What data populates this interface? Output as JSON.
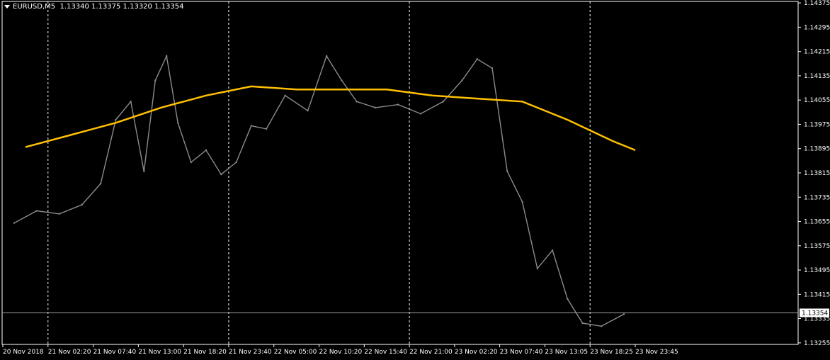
{
  "window": {
    "symbol": "EURUSD,M5",
    "quote": "1.13340 1.13375 1.13320 1.13354"
  },
  "chart_data": {
    "type": "line",
    "symbol": "EURUSD",
    "timeframe": "M5",
    "x_tick_labels": [
      "20 Nov 2018",
      "21 Nov 02:20",
      "21 Nov 07:40",
      "21 Nov 13:00",
      "21 Nov 18:20",
      "21 Nov 23:40",
      "22 Nov 05:00",
      "22 Nov 10:20",
      "22 Nov 15:40",
      "22 Nov 21:00",
      "23 Nov 02:20",
      "23 Nov 07:40",
      "23 Nov 13:05",
      "23 Nov 18:25",
      "23 Nov 23:45"
    ],
    "y_tick_labels": [
      "1.14375",
      "1.14295",
      "1.14215",
      "1.14135",
      "1.14055",
      "1.13975",
      "1.13895",
      "1.13815",
      "1.13735",
      "1.13655",
      "1.13575",
      "1.13495",
      "1.13415",
      "1.13335",
      "1.13255"
    ],
    "ylim": [
      1.1325,
      1.1438
    ],
    "current_price": "1.13354",
    "grid": "vertical dashed day separators",
    "colors": {
      "background": "#000000",
      "price": "#8c8c8c",
      "up": "#22cc22",
      "ma": "#ffc000",
      "axis": "#ffffff"
    },
    "series": [
      {
        "role": "price",
        "points": [
          [
            "20 Nov 2018",
            1.1365
          ],
          [
            "20 Nov 2018",
            1.1369
          ],
          [
            "21 Nov 02:20",
            1.1368
          ],
          [
            "21 Nov 02:20",
            1.1371
          ],
          [
            "21 Nov 07:40",
            1.1378
          ],
          [
            "21 Nov 07:40",
            1.1399
          ],
          [
            "21 Nov 07:40",
            1.1405
          ],
          [
            "21 Nov 13:00",
            1.1382
          ],
          [
            "21 Nov 13:00",
            1.1412
          ],
          [
            "21 Nov 13:00",
            1.142
          ],
          [
            "21 Nov 13:00",
            1.1398
          ],
          [
            "21 Nov 18:20",
            1.1385
          ],
          [
            "21 Nov 18:20",
            1.1389
          ],
          [
            "21 Nov 18:20",
            1.1381
          ],
          [
            "21 Nov 23:40",
            1.1385
          ],
          [
            "21 Nov 23:40",
            1.1397
          ],
          [
            "21 Nov 23:40",
            1.1396
          ],
          [
            "22 Nov 05:00",
            1.1407
          ],
          [
            "22 Nov 05:00",
            1.1402
          ],
          [
            "22 Nov 10:20",
            1.142
          ],
          [
            "22 Nov 10:20",
            1.1412
          ],
          [
            "22 Nov 10:20",
            1.1405
          ],
          [
            "22 Nov 15:40",
            1.1403
          ],
          [
            "22 Nov 15:40",
            1.1404
          ],
          [
            "22 Nov 21:00",
            1.1401
          ],
          [
            "22 Nov 21:00",
            1.1405
          ],
          [
            "23 Nov 02:20",
            1.1412
          ],
          [
            "23 Nov 02:20",
            1.1419
          ],
          [
            "23 Nov 02:20",
            1.1416
          ],
          [
            "23 Nov 07:40",
            1.1382
          ],
          [
            "23 Nov 07:40",
            1.1372
          ],
          [
            "23 Nov 07:40",
            1.135
          ],
          [
            "23 Nov 13:05",
            1.1356
          ],
          [
            "23 Nov 13:05",
            1.134
          ],
          [
            "23 Nov 13:05",
            1.1332
          ],
          [
            "23 Nov 18:25",
            1.1331
          ],
          [
            "23 Nov 18:25",
            1.1335
          ]
        ]
      },
      {
        "role": "moving-average",
        "points": [
          [
            "20 Nov 2018",
            1.139
          ],
          [
            "21 Nov 02:20",
            1.1394
          ],
          [
            "21 Nov 07:40",
            1.1398
          ],
          [
            "21 Nov 13:00",
            1.1403
          ],
          [
            "21 Nov 18:20",
            1.1407
          ],
          [
            "21 Nov 23:40",
            1.141
          ],
          [
            "22 Nov 05:00",
            1.1409
          ],
          [
            "22 Nov 10:20",
            1.1409
          ],
          [
            "22 Nov 15:40",
            1.1409
          ],
          [
            "22 Nov 21:00",
            1.1407
          ],
          [
            "23 Nov 02:20",
            1.1406
          ],
          [
            "23 Nov 07:40",
            1.1405
          ],
          [
            "23 Nov 13:05",
            1.1399
          ],
          [
            "23 Nov 18:25",
            1.1392
          ],
          [
            "23 Nov 23:45",
            1.1389
          ]
        ]
      }
    ]
  }
}
